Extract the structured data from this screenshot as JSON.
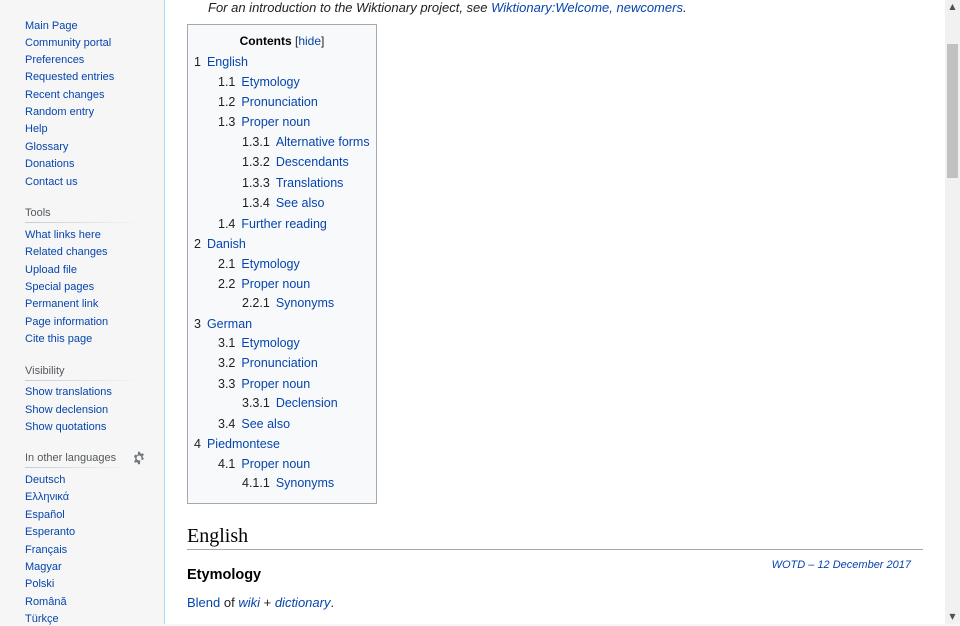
{
  "sidebar": {
    "nav": [
      "Main Page",
      "Community portal",
      "Preferences",
      "Requested entries",
      "Recent changes",
      "Random entry",
      "Help",
      "Glossary",
      "Donations",
      "Contact us"
    ],
    "tools_heading": "Tools",
    "tools": [
      "What links here",
      "Related changes",
      "Upload file",
      "Special pages",
      "Permanent link",
      "Page information",
      "Cite this page"
    ],
    "visibility_heading": "Visibility",
    "visibility": [
      "Show translations",
      "Show declension",
      "Show quotations"
    ],
    "languages_heading": "In other languages",
    "languages": [
      "Deutsch",
      "Ελληνικά",
      "Español",
      "Esperanto",
      "Français",
      "Magyar",
      "Polski",
      "Română",
      "Türkçe"
    ],
    "settings_icon": "gear-icon"
  },
  "intro": {
    "prefix": "For an introduction to the Wiktionary project, see ",
    "link1": "Wiktionary:Welcome, newcomers",
    "suffix": "."
  },
  "toc": {
    "title": "Contents",
    "bracket_open": "[",
    "hide_label": "hide",
    "bracket_close": "]",
    "items": [
      {
        "num": "1",
        "label": "English"
      },
      {
        "num": "1.1",
        "label": "Etymology"
      },
      {
        "num": "1.2",
        "label": "Pronunciation"
      },
      {
        "num": "1.3",
        "label": "Proper noun"
      },
      {
        "num": "1.3.1",
        "label": "Alternative forms"
      },
      {
        "num": "1.3.2",
        "label": "Descendants"
      },
      {
        "num": "1.3.3",
        "label": "Translations"
      },
      {
        "num": "1.3.4",
        "label": "See also"
      },
      {
        "num": "1.4",
        "label": "Further reading"
      },
      {
        "num": "2",
        "label": "Danish"
      },
      {
        "num": "2.1",
        "label": "Etymology"
      },
      {
        "num": "2.2",
        "label": "Proper noun"
      },
      {
        "num": "2.2.1",
        "label": "Synonyms"
      },
      {
        "num": "3",
        "label": "German"
      },
      {
        "num": "3.1",
        "label": "Etymology"
      },
      {
        "num": "3.2",
        "label": "Pronunciation"
      },
      {
        "num": "3.3",
        "label": "Proper noun"
      },
      {
        "num": "3.3.1",
        "label": "Declension"
      },
      {
        "num": "3.4",
        "label": "See also"
      },
      {
        "num": "4",
        "label": "Piedmontese"
      },
      {
        "num": "4.1",
        "label": "Proper noun"
      },
      {
        "num": "4.1.1",
        "label": "Synonyms"
      }
    ]
  },
  "section": {
    "heading": "English",
    "subheading": "Etymology",
    "wotd": "WOTD – 12 December 2017",
    "para_link1": "Blend",
    "para_of": " of ",
    "para_link2": "wiki",
    "para_plus": " + ",
    "para_link3": "dictionary",
    "para_end": "."
  },
  "scrollbar": {
    "up": "▲",
    "down": "▼"
  }
}
